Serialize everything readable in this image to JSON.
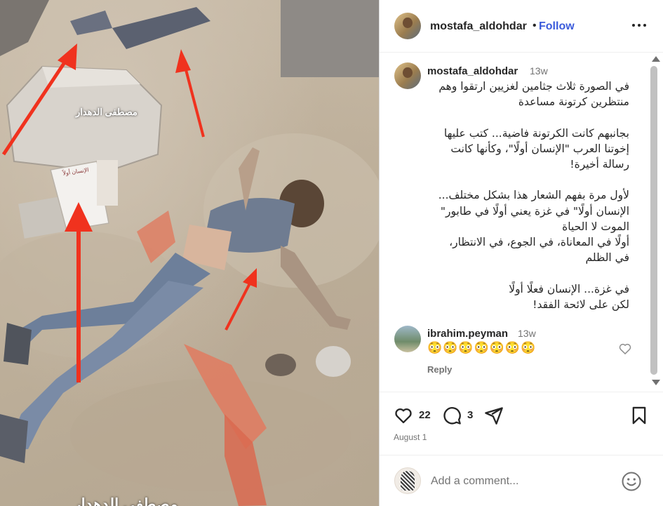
{
  "photo": {
    "caption_overlay": "مصطفى الدهدار",
    "watermark": "مصطفى الدهدار",
    "box_label": "الإنسان أولاً"
  },
  "post": {
    "username": "mostafa_aldohdar",
    "separator": "•",
    "follow_label": "Follow",
    "more_icon": "more-horizontal-icon",
    "caption": {
      "username": "mostafa_aldohdar",
      "time": "13w",
      "text": "في الصورة ثلاث جثامين لغزيين ارتقوا وهم\nمنتظرين كرتونة مساعدة\n\nبجانبهم كانت الكرتونة فاضية... كتب عليها\nإخوتنا العرب \"الإنسان أولًا\"، وكأنها كانت\nرسالة أخيرة!\n\nلأول مرة بفهم الشعار هذا بشكل مختلف...\nالإنسان أولًا\" في غزة يعني أولًا في طابور\"\nالموت لا الحياة\nأولًا في المعاناة، في الجوع، في الانتظار،\nفي الظلم\n\nفي غزة... الإنسان فعلًا أولًا\nلكن على لائحة الفقد!"
    },
    "comments": [
      {
        "username": "ibrahim.peyman",
        "time": "13w",
        "text": "😳😳😳😳😳😳😳",
        "reply_label": "Reply"
      }
    ],
    "likes": "22",
    "comments_count": "3",
    "date": "August 1",
    "add_comment_placeholder": "Add a comment..."
  },
  "colors": {
    "follow": "#3b5bdb",
    "arrow": "#f0321e",
    "muted": "#737373"
  }
}
